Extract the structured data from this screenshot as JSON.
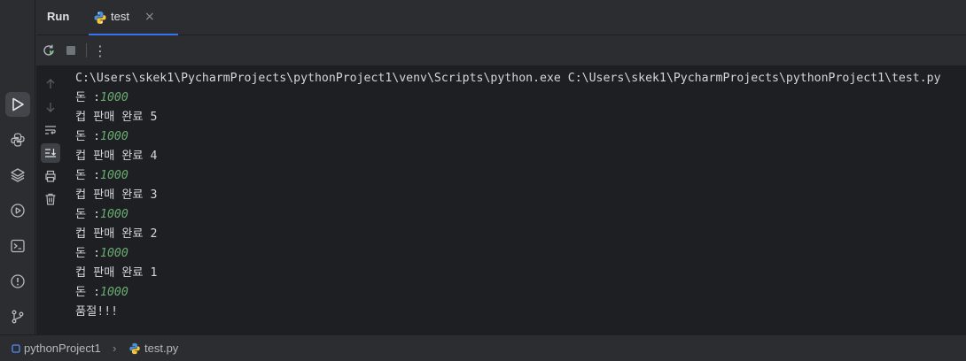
{
  "header": {
    "run_title": "Run",
    "tab": {
      "label": "test",
      "close": "×"
    }
  },
  "toolbar": {
    "rerun_icon": "rerun-icon",
    "stop_icon": "stop-icon",
    "more_label": "⋮"
  },
  "console": {
    "command": "C:\\Users\\skek1\\PycharmProjects\\pythonProject1\\venv\\Scripts\\python.exe C:\\Users\\skek1\\PycharmProjects\\pythonProject1\\test.py",
    "lines": [
      {
        "label": "돈 :",
        "value": "1000"
      },
      {
        "label": "컵 판매 완료 5",
        "value": ""
      },
      {
        "label": "돈 :",
        "value": "1000"
      },
      {
        "label": "컵 판매 완료 4",
        "value": ""
      },
      {
        "label": "돈 :",
        "value": "1000"
      },
      {
        "label": "컵 판매 완료 3",
        "value": ""
      },
      {
        "label": "돈 :",
        "value": "1000"
      },
      {
        "label": "컵 판매 완료 2",
        "value": ""
      },
      {
        "label": "돈 :",
        "value": "1000"
      },
      {
        "label": "컵 판매 완료 1",
        "value": ""
      },
      {
        "label": "돈 :",
        "value": "1000"
      },
      {
        "label": "품절!!!",
        "value": ""
      }
    ]
  },
  "statusbar": {
    "project": "pythonProject1",
    "separator": "›",
    "file": "test.py"
  },
  "colors": {
    "accent": "#3574f0",
    "number": "#6aab73",
    "console_bg": "#1e1f22",
    "panel_bg": "#2b2d30"
  }
}
